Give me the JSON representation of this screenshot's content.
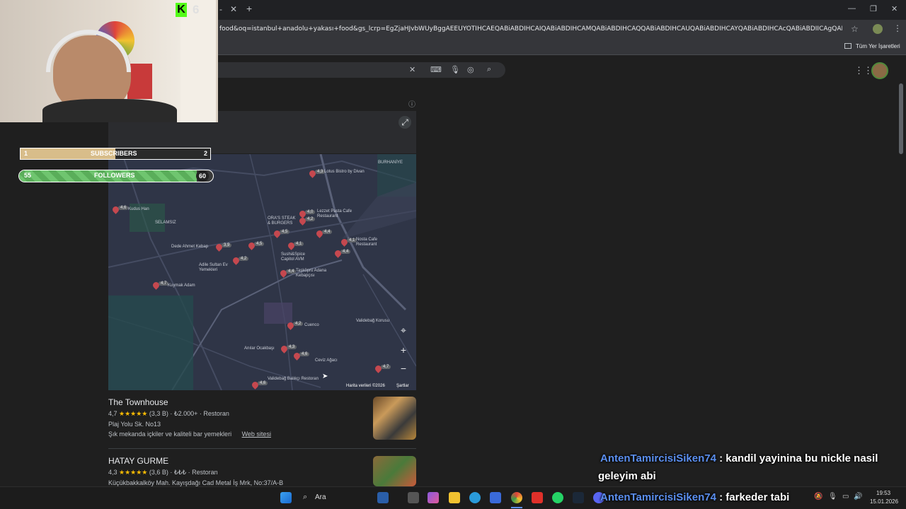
{
  "browser": {
    "url": "food&oq=istanbul+anadolu+yakası+food&gs_lcrp=EgZjaHJvbWUyBggAEEUYOTIHCAEQABiABDIHCAIQABiABDIHCAMQABiABDIHCAQQABiABDIHCAUQABiABDIHCAYQABiABDIHCAcQABiABDIICAgQABgWGB4yCA...",
    "bookmarks_label": "Tüm Yer İşaretleri"
  },
  "overlay": {
    "subscribers": {
      "label": "SUBSCRIBERS",
      "current": "1",
      "goal": "2",
      "fraction": 0.5
    },
    "followers": {
      "label": "FOLLOWERS",
      "current": "55",
      "goal": "60",
      "fraction": 0.917
    }
  },
  "map": {
    "labels": {
      "burhaniye": "BURHANİYE",
      "lotus": "Lotus Bistro by Divan",
      "lezzet": "Lezzet Pasta Cafe Restaurant",
      "kudus": "Kudus Han",
      "selamsiz": "SELAMSIZ",
      "horas": "ORA'S STEAK & BURGERS",
      "nosta": "Nosta Cafe Restaurant",
      "dede": "Dede Ahmet Kebap",
      "sushi": "Sushi&Spice Capitol AVM",
      "adile": "Adile Sultan Ev Yemekleri",
      "taskopru": "Taşköprü Adana Kebapçısı",
      "kuymak": "Kuymak Adam",
      "cuenco": "Cuenco",
      "valide": "Validebağ Korusu",
      "anilar": "Anılar Ocakbaşı",
      "ceviz": "Ceviz Ağacı",
      "validebagbalik": "Validebağ Balıkçı Restoran",
      "credit": "Harita verileri ©2026",
      "terms": "Şartlar"
    },
    "ratings": [
      "4,3",
      "4,6",
      "4,0",
      "4,2",
      "4,5",
      "4,4",
      "4,1",
      "4,1",
      "4,4",
      "3,9",
      "4,5",
      "4,2",
      "4,4",
      "4,7",
      "4,2",
      "4,3",
      "4,6",
      "4,7",
      "4,6",
      "4,1"
    ]
  },
  "results": [
    {
      "title": "The Townhouse",
      "rating": "4,7",
      "stars": "★★★★★",
      "reviews": "(3,3 B)",
      "price": "₺2.000+",
      "type": "Restoran",
      "address": "Plaj Yolu Sk. No13",
      "desc": "Şık mekanda içkiler ve kaliteli bar yemekleri",
      "link": "Web sitesi"
    },
    {
      "title": "HATAY GURME",
      "rating": "4,3",
      "stars": "★★★★★",
      "reviews": "(3,6 B)",
      "price": "₺₺₺",
      "type": "Restoran",
      "address": "Küçükbakkalköy Mah. Kayışdağı Cad Metal İş Mrk, No:37/A-B"
    }
  ],
  "chat": [
    {
      "user": "AntenTamircisiSiken74",
      "msg": ": kandil yayinina bu nickle nasil",
      "msg2": "geleyim abi"
    },
    {
      "user": "AntenTamircisiSiken74",
      "msg": ": farkeder tabi"
    }
  ],
  "taskbar": {
    "search": "Ara",
    "time": "19:53",
    "date": "15.01.2026"
  },
  "colors": {
    "accent": "#5b8ff0",
    "pin": "#c5484f",
    "star": "#fbbc04"
  }
}
